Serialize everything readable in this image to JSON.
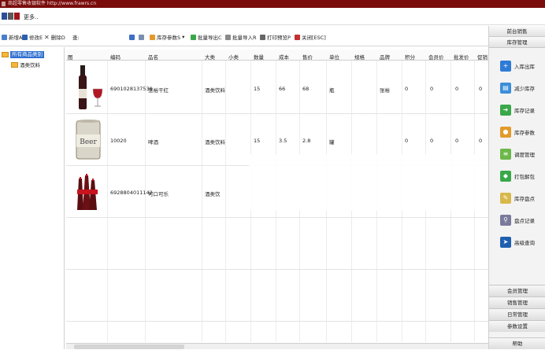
{
  "window": {
    "title": "商超零售收银软件  http://www.frawrs.cn"
  },
  "menubar": {
    "more": "更多.."
  },
  "toolbar": {
    "new": "新增A",
    "edit": "修改E",
    "delete": "删除D",
    "search_label": "查:",
    "search_value": "",
    "stock_params": "库存参数S",
    "batch_export": "批量导出C",
    "batch_import": "批量导入R",
    "print_preview": "打印预览P",
    "close": "关闭[ESC]"
  },
  "tree": {
    "root": "所有商品类别",
    "child": "酒类饮料"
  },
  "grid": {
    "columns": [
      "图",
      "编码",
      "品名",
      "大类",
      "小类",
      "数量",
      "成本",
      "售价",
      "单位",
      "规格",
      "品牌",
      "积分",
      "会员价",
      "批发价",
      "促销"
    ],
    "rows": [
      {
        "image": "wine-bottle",
        "code": "6901028137538",
        "name": "张裕干红",
        "major": "酒类饮料",
        "minor": "",
        "qty": "15",
        "cost": "66",
        "price": "68",
        "unit": "瓶",
        "spec": "",
        "brand": "张裕",
        "points": "0",
        "member": "0",
        "wholesale": "0",
        "promo": "0"
      },
      {
        "image": "beer-can",
        "code": "10020",
        "name": "啤酒",
        "major": "酒类饮料",
        "minor": "",
        "qty": "15",
        "cost": "3.5",
        "price": "2.8",
        "unit": "罐",
        "spec": "",
        "brand": "",
        "points": "0",
        "member": "0",
        "wholesale": "0",
        "promo": "0"
      },
      {
        "image": "cola-bottles",
        "code": "6928804011142",
        "name": "可口可乐",
        "major": "酒类饮",
        "minor": "",
        "qty": "",
        "cost": "",
        "price": "",
        "unit": "",
        "spec": "",
        "brand": "",
        "points": "",
        "member": "",
        "wholesale": "",
        "promo": ""
      }
    ]
  },
  "right_panel": {
    "headers": [
      "前台销售",
      "库存管理"
    ],
    "items": [
      {
        "label": "入库出库",
        "icon": "stock-in-icon",
        "color": "#2e7bd6"
      },
      {
        "label": "减少库存",
        "icon": "reduce-stock-icon",
        "color": "#3b8fd9"
      },
      {
        "label": "库存记录",
        "icon": "stock-record-icon",
        "color": "#3aa84a"
      },
      {
        "label": "库存参数",
        "icon": "stock-params-icon",
        "color": "#e39a2b"
      },
      {
        "label": "调度管理",
        "icon": "dispatch-icon",
        "color": "#6cb84a"
      },
      {
        "label": "打包解包",
        "icon": "pack-icon",
        "color": "#3aa84a"
      },
      {
        "label": "库存盘点",
        "icon": "inventory-check-icon",
        "color": "#d8b84a"
      },
      {
        "label": "盘点记录",
        "icon": "check-record-icon",
        "color": "#7a7a9c"
      },
      {
        "label": "高级查询",
        "icon": "advanced-query-icon",
        "color": "#1e5fb0"
      }
    ],
    "bottom": [
      "会员管理",
      "销售管理",
      "日常管理",
      "参数设置",
      "帮助"
    ]
  },
  "colors": {
    "titlebar": "#7a0c0c",
    "tree_selected": "#2f6fd0"
  }
}
